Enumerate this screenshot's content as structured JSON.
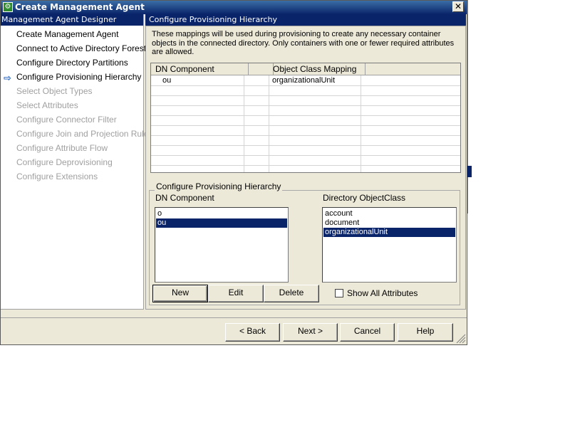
{
  "window": {
    "title": "Create Management Agent",
    "close_glyph": "✕"
  },
  "left_pane": {
    "header": "Management Agent Designer",
    "items": [
      {
        "label": "Create Management Agent",
        "state": "enabled"
      },
      {
        "label": "Connect to Active Directory Forest",
        "state": "enabled"
      },
      {
        "label": "Configure Directory Partitions",
        "state": "enabled"
      },
      {
        "label": "Configure Provisioning Hierarchy",
        "state": "current"
      },
      {
        "label": "Select Object Types",
        "state": "disabled"
      },
      {
        "label": "Select Attributes",
        "state": "disabled"
      },
      {
        "label": "Configure Connector Filter",
        "state": "disabled"
      },
      {
        "label": "Configure Join and Projection Rules",
        "state": "disabled"
      },
      {
        "label": "Configure Attribute Flow",
        "state": "disabled"
      },
      {
        "label": "Configure Deprovisioning",
        "state": "disabled"
      },
      {
        "label": "Configure Extensions",
        "state": "disabled"
      }
    ]
  },
  "right_pane": {
    "header": "Configure Provisioning Hierarchy",
    "description": "These mappings will be used during provisioning to create any necessary container objects in the connected directory.  Only containers with one or fewer required attributes are allowed.",
    "mappings": {
      "columns": [
        "DN Component",
        "Object Class Mapping"
      ],
      "rows": [
        {
          "dn": "ou",
          "object_class": "organizationalUnit"
        }
      ]
    },
    "group": {
      "title": "Configure Provisioning Hierarchy",
      "dn_label": "DN Component",
      "dn_items": [
        {
          "label": "o",
          "selected": false
        },
        {
          "label": "ou",
          "selected": true
        }
      ],
      "class_label": "Directory ObjectClass",
      "class_items": [
        {
          "label": "account",
          "selected": false
        },
        {
          "label": "document",
          "selected": false
        },
        {
          "label": "organizationalUnit",
          "selected": true
        }
      ],
      "new_label": "New",
      "edit_label": "Edit",
      "delete_label": "Delete",
      "show_all_label": "Show All Attributes",
      "show_all_checked": false
    }
  },
  "footer": {
    "back_label": "< Back",
    "next_label": "Next >",
    "cancel_label": "Cancel",
    "help_label": "Help"
  },
  "colors": {
    "selection": "#0a246a",
    "dialog_bg": "#ece9d8",
    "disabled_text": "#a0a0a0"
  }
}
